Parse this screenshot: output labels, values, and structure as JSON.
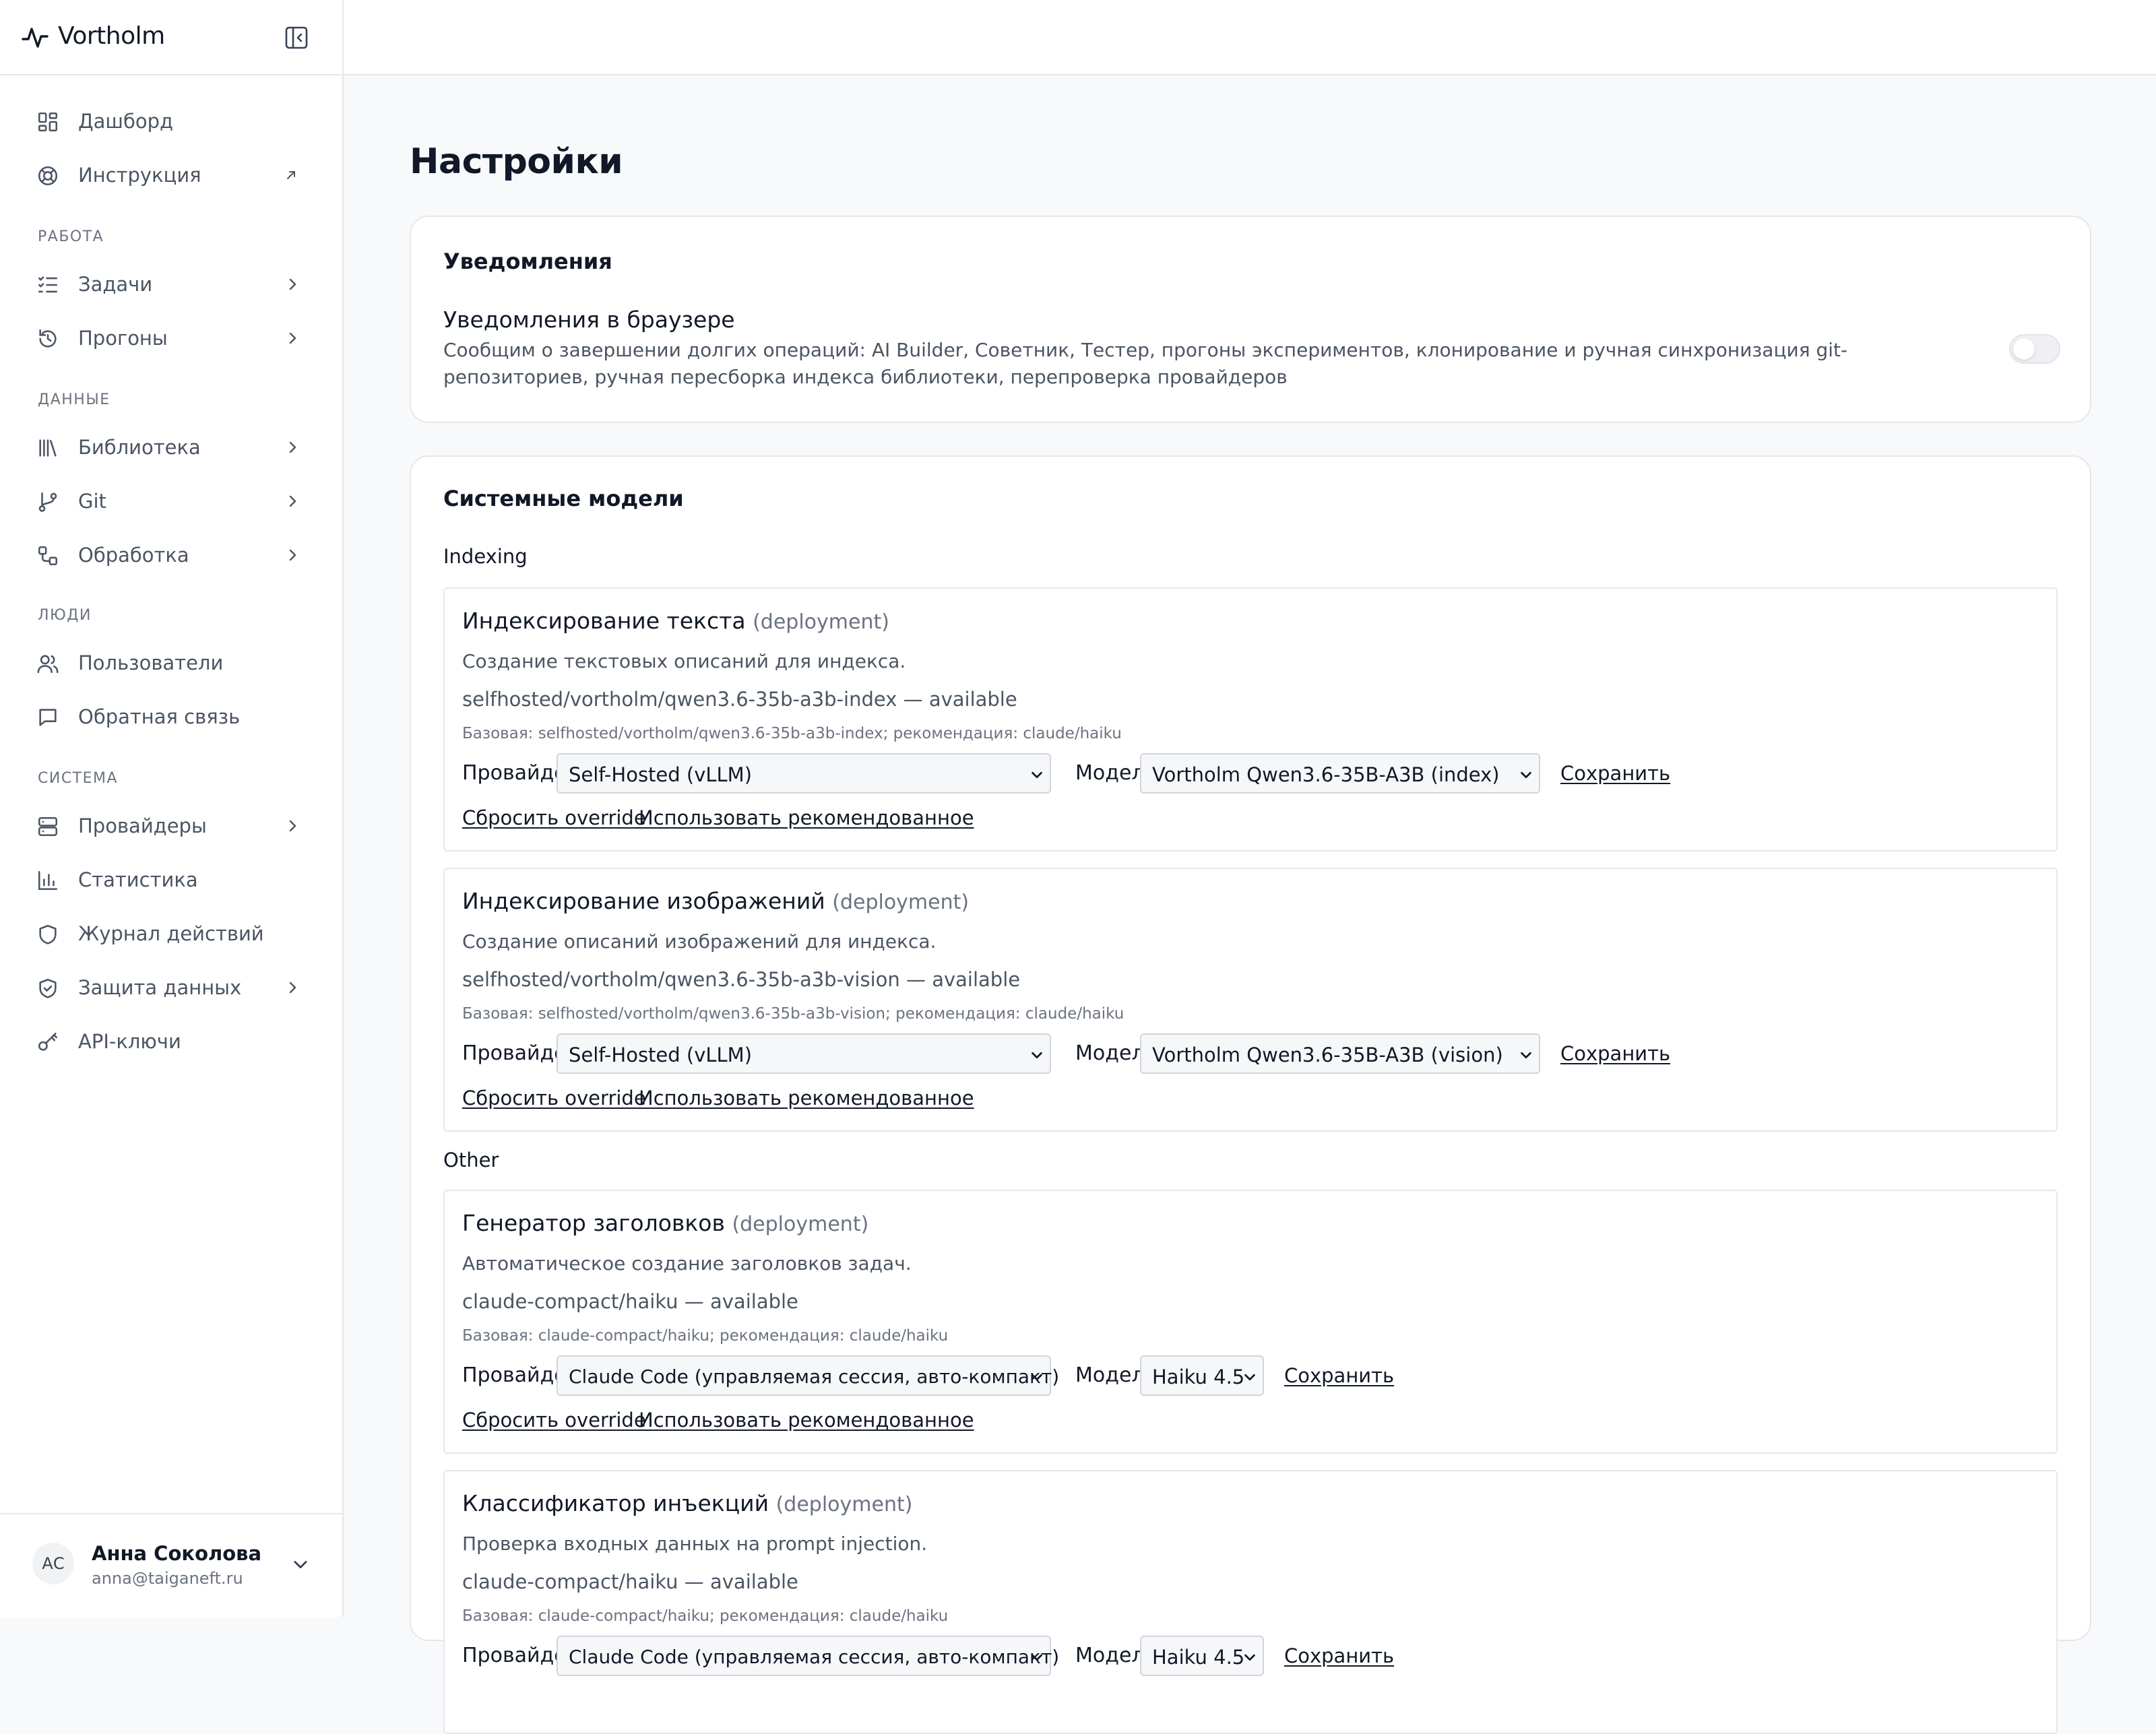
{
  "app": {
    "brand": "Vortholm",
    "page_title": "Настройки"
  },
  "sidebar": {
    "top_items": [
      {
        "label": "Дашборд",
        "icon": "dashboard-icon"
      },
      {
        "label": "Инструкция",
        "icon": "lifebuoy-icon",
        "external": true
      }
    ],
    "sections": [
      {
        "title": "РАБОТА",
        "items": [
          {
            "label": "Задачи",
            "icon": "task-list-icon",
            "expandable": true
          },
          {
            "label": "Прогоны",
            "icon": "history-icon",
            "expandable": true
          }
        ]
      },
      {
        "title": "ДАННЫЕ",
        "items": [
          {
            "label": "Библиотека",
            "icon": "library-icon",
            "expandable": true
          },
          {
            "label": "Git",
            "icon": "git-branch-icon",
            "expandable": true
          },
          {
            "label": "Обработка",
            "icon": "workflow-icon",
            "expandable": true
          }
        ]
      },
      {
        "title": "ЛЮДИ",
        "items": [
          {
            "label": "Пользователи",
            "icon": "users-icon"
          },
          {
            "label": "Обратная связь",
            "icon": "message-square-icon"
          }
        ]
      },
      {
        "title": "СИСТЕМА",
        "items": [
          {
            "label": "Провайдеры",
            "icon": "server-icon",
            "expandable": true
          },
          {
            "label": "Статистика",
            "icon": "bar-chart-icon"
          },
          {
            "label": "Журнал действий",
            "icon": "shield-icon"
          },
          {
            "label": "Защита данных",
            "icon": "shield-check-icon",
            "expandable": true
          },
          {
            "label": "API-ключи",
            "icon": "key-icon"
          }
        ]
      }
    ],
    "user": {
      "initials": "АС",
      "name": "Анна Соколова",
      "email": "anna@taiganeft.ru"
    }
  },
  "notifications": {
    "title": "Уведомления",
    "browser_heading": "Уведомления в браузере",
    "browser_description": "Сообщим о завершении долгих операций: AI Builder, Советник, Тестер, прогоны экспериментов, клонирование и ручная синхронизация git-репозиториев, ручная пересборка индекса библиотеки, перепроверка провайдеров",
    "browser_enabled": false
  },
  "system_models": {
    "title": "Системные модели",
    "labels": {
      "provider": "Провайдер",
      "model": "Модель",
      "save": "Сохранить",
      "reset": "Сбросить override",
      "use_recommended": "Использовать рекомендованное"
    },
    "groups": [
      {
        "label": "Indexing",
        "models": [
          {
            "title": "Индексирование текста",
            "tag": "(deployment)",
            "description": "Создание текстовых описаний для индекса.",
            "status": "selfhosted/vortholm/qwen3.6-35b-a3b-index — available",
            "base": "Базовая: selfhosted/vortholm/qwen3.6-35b-a3b-index; рекомендация: claude/haiku",
            "provider": "Self-Hosted (vLLM)",
            "model": "Vortholm Qwen3.6-35B-A3B (index)"
          },
          {
            "title": "Индексирование изображений",
            "tag": "(deployment)",
            "description": "Создание описаний изображений для индекса.",
            "status": "selfhosted/vortholm/qwen3.6-35b-a3b-vision — available",
            "base": "Базовая: selfhosted/vortholm/qwen3.6-35b-a3b-vision; рекомендация: claude/haiku",
            "provider": "Self-Hosted (vLLM)",
            "model": "Vortholm Qwen3.6-35B-A3B (vision)"
          }
        ]
      },
      {
        "label": "Other",
        "models": [
          {
            "title": "Генератор заголовков",
            "tag": "(deployment)",
            "description": "Автоматическое создание заголовков задач.",
            "status": "claude-compact/haiku — available",
            "base": "Базовая: claude-compact/haiku; рекомендация: claude/haiku",
            "provider": "Claude Code (управляемая сессия, авто-компакт)",
            "model": "Haiku 4.5"
          },
          {
            "title": "Классификатор инъекций",
            "tag": "(deployment)",
            "description": "Проверка входных данных на prompt injection.",
            "status": "claude-compact/haiku — available",
            "base": "Базовая: claude-compact/haiku; рекомендация: claude/haiku",
            "provider": "Claude Code (управляемая сессия, авто-компакт)",
            "model": "Haiku 4.5"
          }
        ]
      }
    ]
  }
}
